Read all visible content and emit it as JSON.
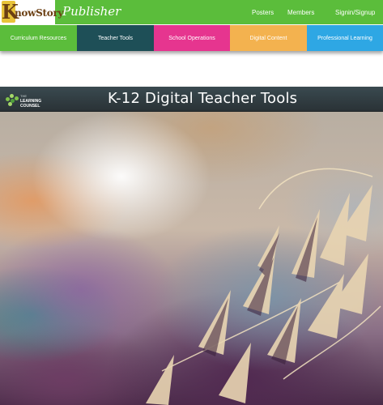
{
  "header": {
    "logo_initial": "K",
    "logo_text": "nowStory",
    "publisher": "Publisher",
    "links": {
      "posters": "Posters",
      "members": "Members",
      "signin": "Signin/Signup"
    }
  },
  "nav": {
    "items": [
      {
        "label": "Curriculum Resources",
        "color": "#5bbd3b"
      },
      {
        "label": "Teacher Tools",
        "color": "#1e4f57"
      },
      {
        "label": "School Operations",
        "color": "#e6358f"
      },
      {
        "label": "Digital Content",
        "color": "#f3b24f"
      },
      {
        "label": "Professional Learning",
        "color": "#2ea7e4"
      }
    ]
  },
  "banner": {
    "logo_line1": "THE",
    "logo_line2": "LEARNING",
    "logo_line3": "COUNSEL",
    "title": "K-12 Digital Teacher Tools"
  }
}
